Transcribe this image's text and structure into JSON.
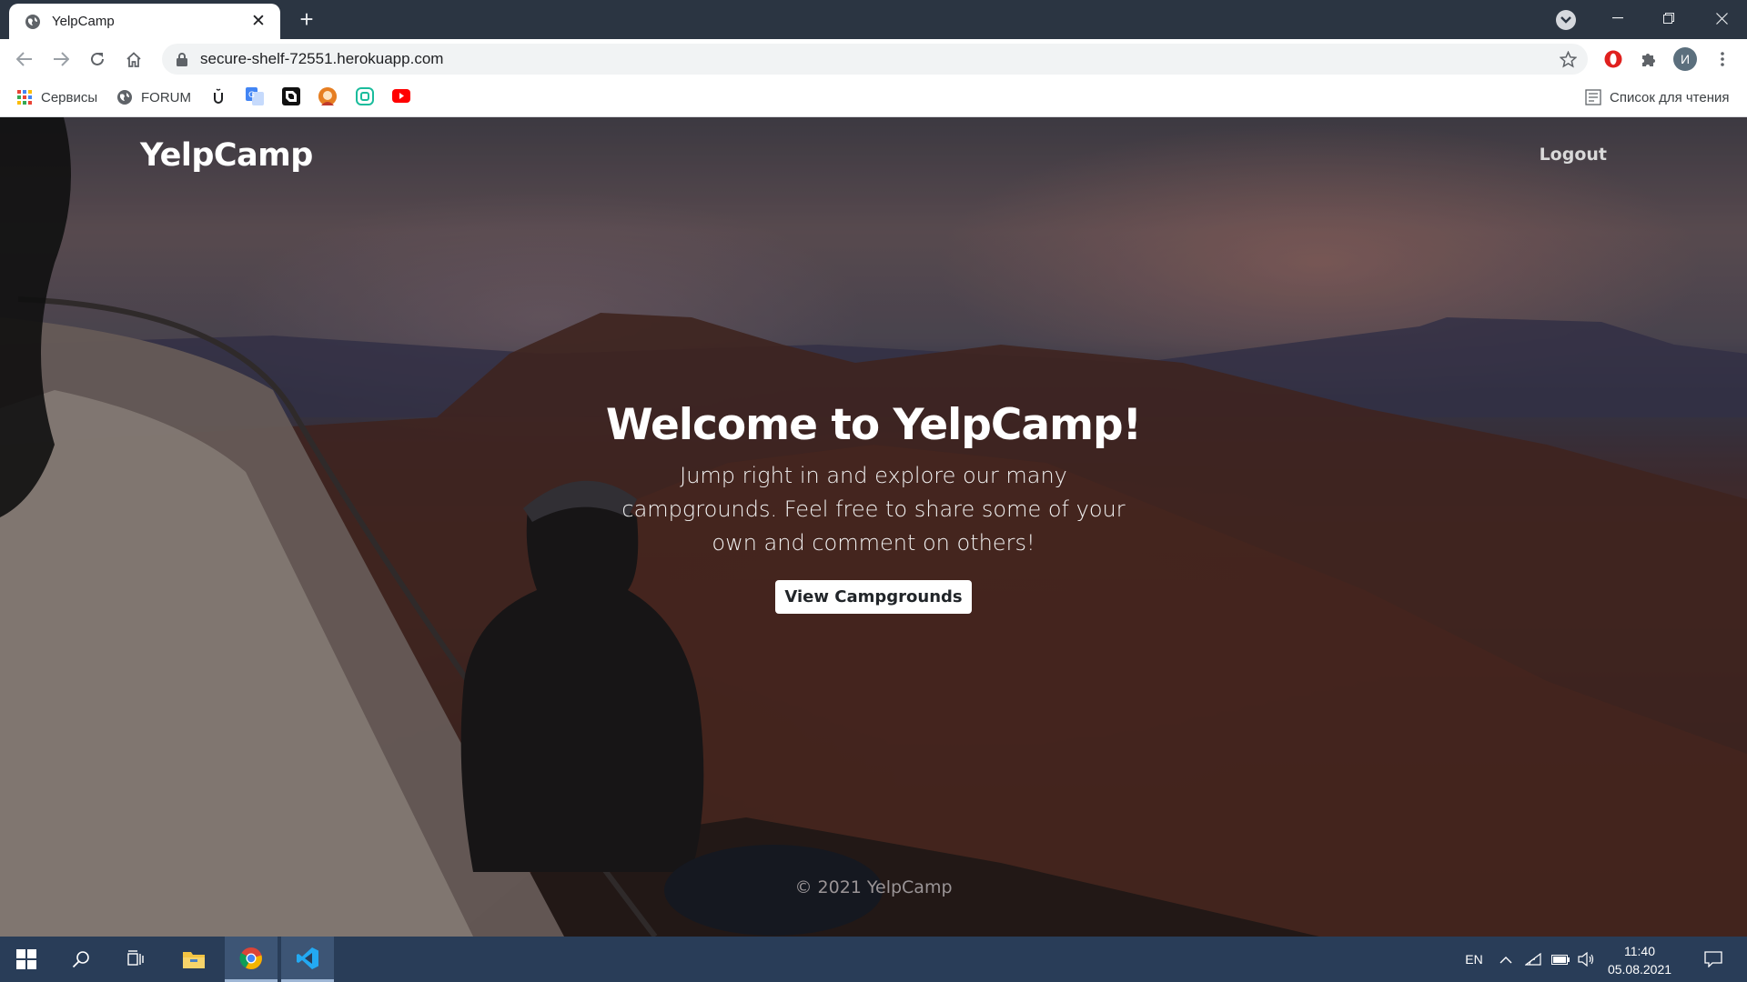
{
  "browser": {
    "tab_title": "YelpCamp",
    "url": "secure-shelf-72551.herokuapp.com",
    "profile_initial": "И",
    "bookmarks": {
      "services_label": "Сервисы",
      "forum_label": "FORUM",
      "reading_list_label": "Список для чтения"
    }
  },
  "page": {
    "brand": "YelpCamp",
    "logout_label": "Logout",
    "hero": {
      "title": "Welcome to YelpCamp!",
      "subtitle": "Jump right in and explore our many campgrounds. Feel free to share some of your own and comment on others!",
      "cta_label": "View Campgrounds"
    },
    "footer": "© 2021 YelpCamp"
  },
  "taskbar": {
    "language": "EN",
    "time": "11:40",
    "date": "05.08.2021"
  },
  "colors": {
    "chrome_dark": "#2b3542",
    "taskbar": "#293d58",
    "hero_text": "#ffffff"
  }
}
